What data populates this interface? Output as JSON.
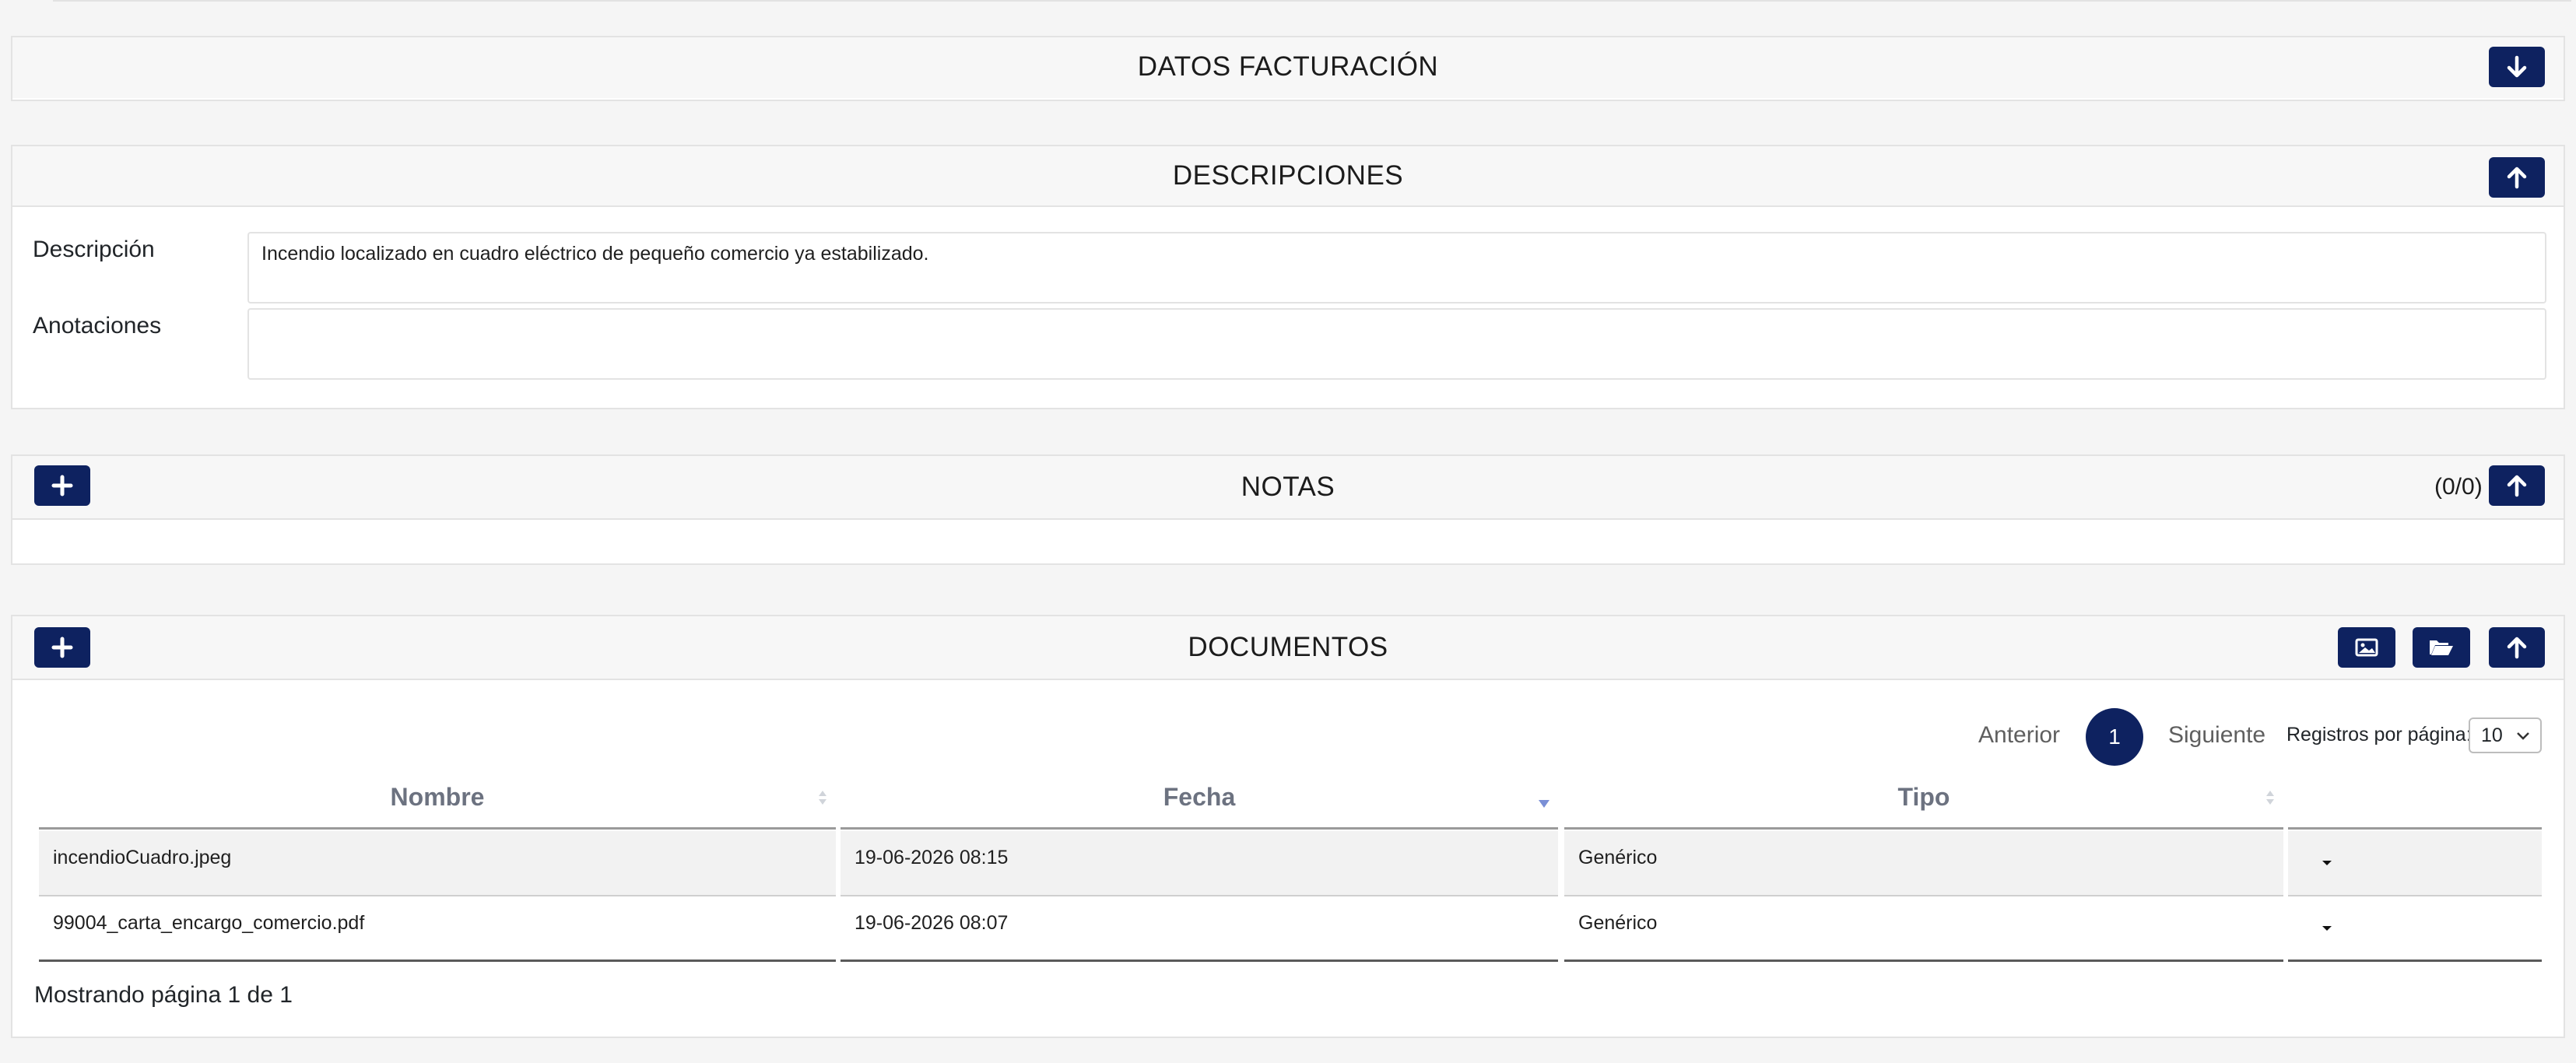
{
  "sections": {
    "billing": {
      "title": "DATOS FACTURACIÓN"
    },
    "descriptions": {
      "title": "DESCRIPCIONES",
      "description_label": "Descripción",
      "description_value": "Incendio localizado en cuadro eléctrico de pequeño comercio ya estabilizado.",
      "annotations_label": "Anotaciones",
      "annotations_value": ""
    },
    "notes": {
      "title": "NOTAS",
      "count": "(0/0)"
    },
    "documents": {
      "title": "DOCUMENTOS",
      "pager": {
        "prev": "Anterior",
        "current": "1",
        "next": "Siguiente"
      },
      "rows_per_page_label": "Registros por página:",
      "rows_per_page_value": "10",
      "columns": [
        "Nombre",
        "Fecha",
        "Tipo"
      ],
      "rows": [
        {
          "name": "incendioCuadro.jpeg",
          "date": "19-06-2026 08:15",
          "type": "Genérico"
        },
        {
          "name": "99004_carta_encargo_comercio.pdf",
          "date": "19-06-2026 08:07",
          "type": "Genérico"
        }
      ],
      "footer": "Mostrando página 1 de 1"
    }
  },
  "icons": {
    "expand": "arrow-down-icon",
    "collapse": "arrow-up-icon",
    "add": "plus-icon",
    "image": "image-icon",
    "folder": "folder-open-icon",
    "row_menu": "caret-down-icon"
  },
  "colors": {
    "primary": "#0e2260",
    "header_bg": "#f7f7f7",
    "border": "#e3e3e3"
  }
}
